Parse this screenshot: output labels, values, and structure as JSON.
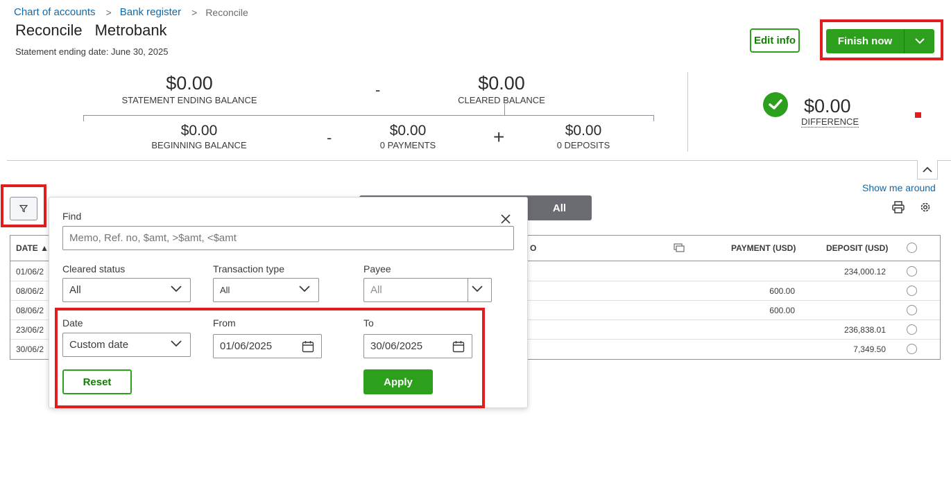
{
  "breadcrumb": {
    "chart_of_accounts": "Chart of accounts",
    "bank_register": "Bank register",
    "current": "Reconcile",
    "separator": ">"
  },
  "header": {
    "title": "Reconcile",
    "account": "Metrobank",
    "statement_date": "Statement ending date: June 30, 2025",
    "edit_info": "Edit info",
    "finish_now": "Finish now"
  },
  "summary": {
    "statement_ending_balance": "$0.00",
    "statement_ending_label": "STATEMENT ENDING BALANCE",
    "minus": "-",
    "cleared_balance": "$0.00",
    "cleared_label": "CLEARED BALANCE",
    "beginning_balance": "$0.00",
    "beginning_label": "BEGINNING BALANCE",
    "payments": "$0.00",
    "payments_label": "0 PAYMENTS",
    "plus": "+",
    "deposits": "$0.00",
    "deposits_label": "0 DEPOSITS",
    "difference": "$0.00",
    "difference_label": "DIFFERENCE"
  },
  "toolbar": {
    "show_me_around": "Show me around",
    "tab_all": "All"
  },
  "table": {
    "columns": {
      "date": "DATE ▲",
      "memo_partial": "O",
      "payment": "PAYMENT (USD)",
      "deposit": "DEPOSIT (USD)"
    },
    "rows": [
      {
        "date": "01/06/2",
        "payment": "",
        "deposit": "234,000.12"
      },
      {
        "date": "08/06/2",
        "payment": "600.00",
        "deposit": ""
      },
      {
        "date": "08/06/2",
        "payment": "600.00",
        "deposit": ""
      },
      {
        "date": "23/06/2",
        "payment": "",
        "deposit": "236,838.01"
      },
      {
        "date": "30/06/2",
        "payment": "",
        "deposit": "7,349.50"
      }
    ]
  },
  "filter": {
    "find_label": "Find",
    "find_placeholder": "Memo, Ref. no, $amt, >$amt, <$amt",
    "cleared_status_label": "Cleared status",
    "cleared_status_value": "All",
    "transaction_type_label": "Transaction type",
    "transaction_type_value": "All",
    "payee_label": "Payee",
    "payee_placeholder": "All",
    "date_label": "Date",
    "date_value": "Custom date",
    "from_label": "From",
    "from_value": "01/06/2025",
    "to_label": "To",
    "to_value": "30/06/2025",
    "reset": "Reset",
    "apply": "Apply"
  },
  "colors": {
    "brand_green": "#2ca01c",
    "link_blue": "#0d6aa8",
    "highlight_red": "#e01e1e"
  }
}
